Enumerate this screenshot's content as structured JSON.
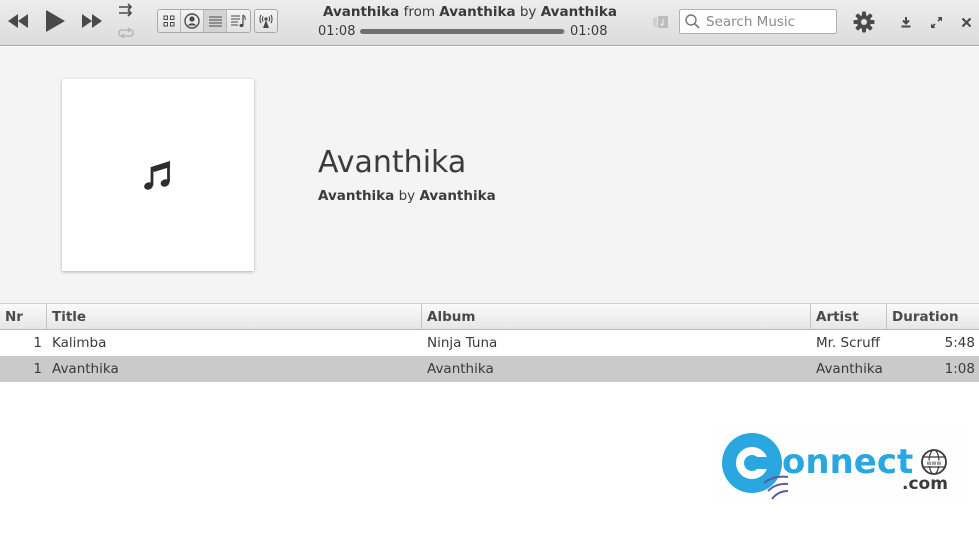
{
  "toolbar": {
    "now_playing": {
      "title": "Avanthika",
      "from_label": "from",
      "album": "Avanthika",
      "by_label": "by",
      "artist": "Avanthika"
    },
    "elapsed": "01:08",
    "total": "01:08",
    "progress_fraction": 0.99,
    "search": {
      "placeholder": "Search Music",
      "value": ""
    },
    "views": [
      {
        "name": "albums-view",
        "active": false
      },
      {
        "name": "artists-view",
        "active": false
      },
      {
        "name": "songs-view",
        "active": true
      },
      {
        "name": "playlists-view",
        "active": false
      }
    ]
  },
  "album_header": {
    "title": "Avanthika",
    "album": "Avanthika",
    "by_label": "by",
    "artist": "Avanthika"
  },
  "table": {
    "columns": [
      "Nr",
      "Title",
      "Album",
      "Artist",
      "Duration"
    ],
    "rows": [
      {
        "nr": "1",
        "title": "Kalimba",
        "album": "Ninja Tuna",
        "artist": "Mr. Scruff",
        "duration": "5:48",
        "selected": false
      },
      {
        "nr": "1",
        "title": "Avanthika",
        "album": "Avanthika",
        "artist": "Avanthika",
        "duration": "1:08",
        "selected": true
      }
    ]
  },
  "watermark": {
    "brand": "onnect",
    "domain": ".com",
    "www": "www",
    "brand_color": "#2aa6e0"
  }
}
